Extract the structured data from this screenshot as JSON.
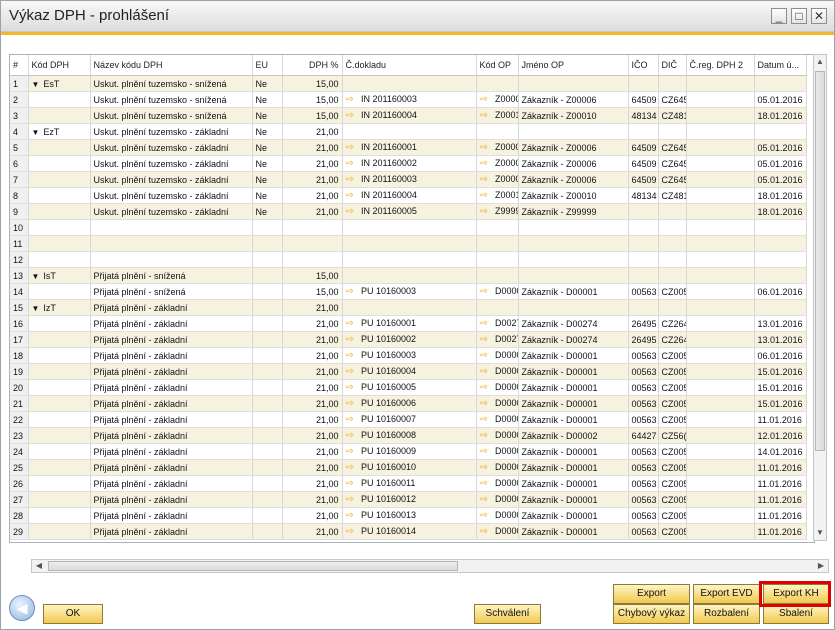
{
  "window": {
    "title": "Výkaz DPH - prohlášení"
  },
  "columns": [
    "#",
    "Kód DPH",
    "Název kódu DPH",
    "EU",
    "DPH %",
    "Č.dokladu",
    "Kód OP",
    "Jméno OP",
    "IČO",
    "DIČ",
    "Č.reg. DPH 2",
    "Datum ú..."
  ],
  "rows": [
    [
      "1",
      "EsT",
      "Uskut. plnění tuzemsko - snížená",
      "Ne",
      "15,00",
      "",
      "",
      "",
      "",
      "",
      "",
      ""
    ],
    [
      "2",
      "",
      "Uskut. plnění tuzemsko - snížená",
      "Ne",
      "15,00",
      "IN 201160003",
      "Z0000",
      "Zákazník - Z00006",
      "64509",
      "CZ645",
      "",
      "05.01.2016"
    ],
    [
      "3",
      "",
      "Uskut. plnění tuzemsko - snížená",
      "Ne",
      "15,00",
      "IN 201160004",
      "Z0001",
      "Zákazník - Z00010",
      "48134",
      "CZ481",
      "",
      "18.01.2016"
    ],
    [
      "4",
      "EzT",
      "Uskut. plnění tuzemsko - základní",
      "Ne",
      "21,00",
      "",
      "",
      "",
      "",
      "",
      "",
      ""
    ],
    [
      "5",
      "",
      "Uskut. plnění tuzemsko - základní",
      "Ne",
      "21,00",
      "IN 201160001",
      "Z0000",
      "Zákazník - Z00006",
      "64509",
      "CZ645",
      "",
      "05.01.2016"
    ],
    [
      "6",
      "",
      "Uskut. plnění tuzemsko - základní",
      "Ne",
      "21,00",
      "IN 201160002",
      "Z0000",
      "Zákazník - Z00006",
      "64509",
      "CZ645",
      "",
      "05.01.2016"
    ],
    [
      "7",
      "",
      "Uskut. plnění tuzemsko - základní",
      "Ne",
      "21,00",
      "IN 201160003",
      "Z0000",
      "Zákazník - Z00006",
      "64509",
      "CZ645",
      "",
      "05.01.2016"
    ],
    [
      "8",
      "",
      "Uskut. plnění tuzemsko - základní",
      "Ne",
      "21,00",
      "IN 201160004",
      "Z0001",
      "Zákazník - Z00010",
      "48134",
      "CZ481",
      "",
      "18.01.2016"
    ],
    [
      "9",
      "",
      "Uskut. plnění tuzemsko - základní",
      "Ne",
      "21,00",
      "IN 201160005",
      "Z9999",
      "Zákazník - Z99999",
      "",
      "",
      "",
      "18.01.2016"
    ],
    [
      "10",
      "",
      "",
      "",
      "",
      "",
      "",
      "",
      "",
      "",
      "",
      ""
    ],
    [
      "11",
      "",
      "",
      "",
      "",
      "",
      "",
      "",
      "",
      "",
      "",
      ""
    ],
    [
      "12",
      "",
      "",
      "",
      "",
      "",
      "",
      "",
      "",
      "",
      "",
      ""
    ],
    [
      "13",
      "IsT",
      "Přijatá plnění - snížená",
      "",
      "15,00",
      "",
      "",
      "",
      "",
      "",
      "",
      ""
    ],
    [
      "14",
      "",
      "Přijatá plnění - snížená",
      "",
      "15,00",
      "PU 10160003",
      "D0000",
      "Zákazník - D00001",
      "00563",
      "CZ005",
      "",
      "06.01.2016"
    ],
    [
      "15",
      "IzT",
      "Přijatá plnění - základní",
      "",
      "21,00",
      "",
      "",
      "",
      "",
      "",
      "",
      ""
    ],
    [
      "16",
      "",
      "Přijatá plnění - základní",
      "",
      "21,00",
      "PU 10160001",
      "D0027",
      "Zákazník - D00274",
      "26495",
      "CZ264",
      "",
      "13.01.2016"
    ],
    [
      "17",
      "",
      "Přijatá plnění - základní",
      "",
      "21,00",
      "PU 10160002",
      "D0027",
      "Zákazník - D00274",
      "26495",
      "CZ264",
      "",
      "13.01.2016"
    ],
    [
      "18",
      "",
      "Přijatá plnění - základní",
      "",
      "21,00",
      "PU 10160003",
      "D0000",
      "Zákazník - D00001",
      "00563",
      "CZ005",
      "",
      "06.01.2016"
    ],
    [
      "19",
      "",
      "Přijatá plnění - základní",
      "",
      "21,00",
      "PU 10160004",
      "D0000",
      "Zákazník - D00001",
      "00563",
      "CZ005",
      "",
      "15.01.2016"
    ],
    [
      "20",
      "",
      "Přijatá plnění - základní",
      "",
      "21,00",
      "PU 10160005",
      "D0000",
      "Zákazník - D00001",
      "00563",
      "CZ005",
      "",
      "15.01.2016"
    ],
    [
      "21",
      "",
      "Přijatá plnění - základní",
      "",
      "21,00",
      "PU 10160006",
      "D0000",
      "Zákazník - D00001",
      "00563",
      "CZ005",
      "",
      "15.01.2016"
    ],
    [
      "22",
      "",
      "Přijatá plnění - základní",
      "",
      "21,00",
      "PU 10160007",
      "D0000",
      "Zákazník - D00001",
      "00563",
      "CZ005",
      "",
      "11.01.2016"
    ],
    [
      "23",
      "",
      "Přijatá plnění - základní",
      "",
      "21,00",
      "PU 10160008",
      "D0000",
      "Zákazník - D00002",
      "64427",
      "CZ56(",
      "",
      "12.01.2016"
    ],
    [
      "24",
      "",
      "Přijatá plnění - základní",
      "",
      "21,00",
      "PU 10160009",
      "D0000",
      "Zákazník - D00001",
      "00563",
      "CZ005",
      "",
      "14.01.2016"
    ],
    [
      "25",
      "",
      "Přijatá plnění - základní",
      "",
      "21,00",
      "PU 10160010",
      "D0000",
      "Zákazník - D00001",
      "00563",
      "CZ005",
      "",
      "11.01.2016"
    ],
    [
      "26",
      "",
      "Přijatá plnění - základní",
      "",
      "21,00",
      "PU 10160011",
      "D0000",
      "Zákazník - D00001",
      "00563",
      "CZ005",
      "",
      "11.01.2016"
    ],
    [
      "27",
      "",
      "Přijatá plnění - základní",
      "",
      "21,00",
      "PU 10160012",
      "D0000",
      "Zákazník - D00001",
      "00563",
      "CZ005",
      "",
      "11.01.2016"
    ],
    [
      "28",
      "",
      "Přijatá plnění - základní",
      "",
      "21,00",
      "PU 10160013",
      "D0000",
      "Zákazník - D00001",
      "00563",
      "CZ005",
      "",
      "11.01.2016"
    ],
    [
      "29",
      "",
      "Přijatá plnění - základní",
      "",
      "21,00",
      "PU 10160014",
      "D0000",
      "Zákazník - D00001",
      "00563",
      "CZ005",
      "",
      "11.01.2016"
    ]
  ],
  "buttons": {
    "ok": "OK",
    "schvaleni": "Schválení",
    "export": "Export",
    "export_evd": "Export EVD",
    "export_kh": "Export KH",
    "chybovy_vykaz": "Chybový výkaz",
    "rozbaleni": "Rozbalení",
    "sbaleni": "Sbalení"
  },
  "icons": {
    "row_link": "link-arrow-icon",
    "expand": "triangle-down-icon",
    "back": "back-arrow-icon"
  },
  "colors": {
    "accent": "#f2b82b",
    "highlight": "#e00000",
    "row_alt": "#f7f2e0"
  }
}
